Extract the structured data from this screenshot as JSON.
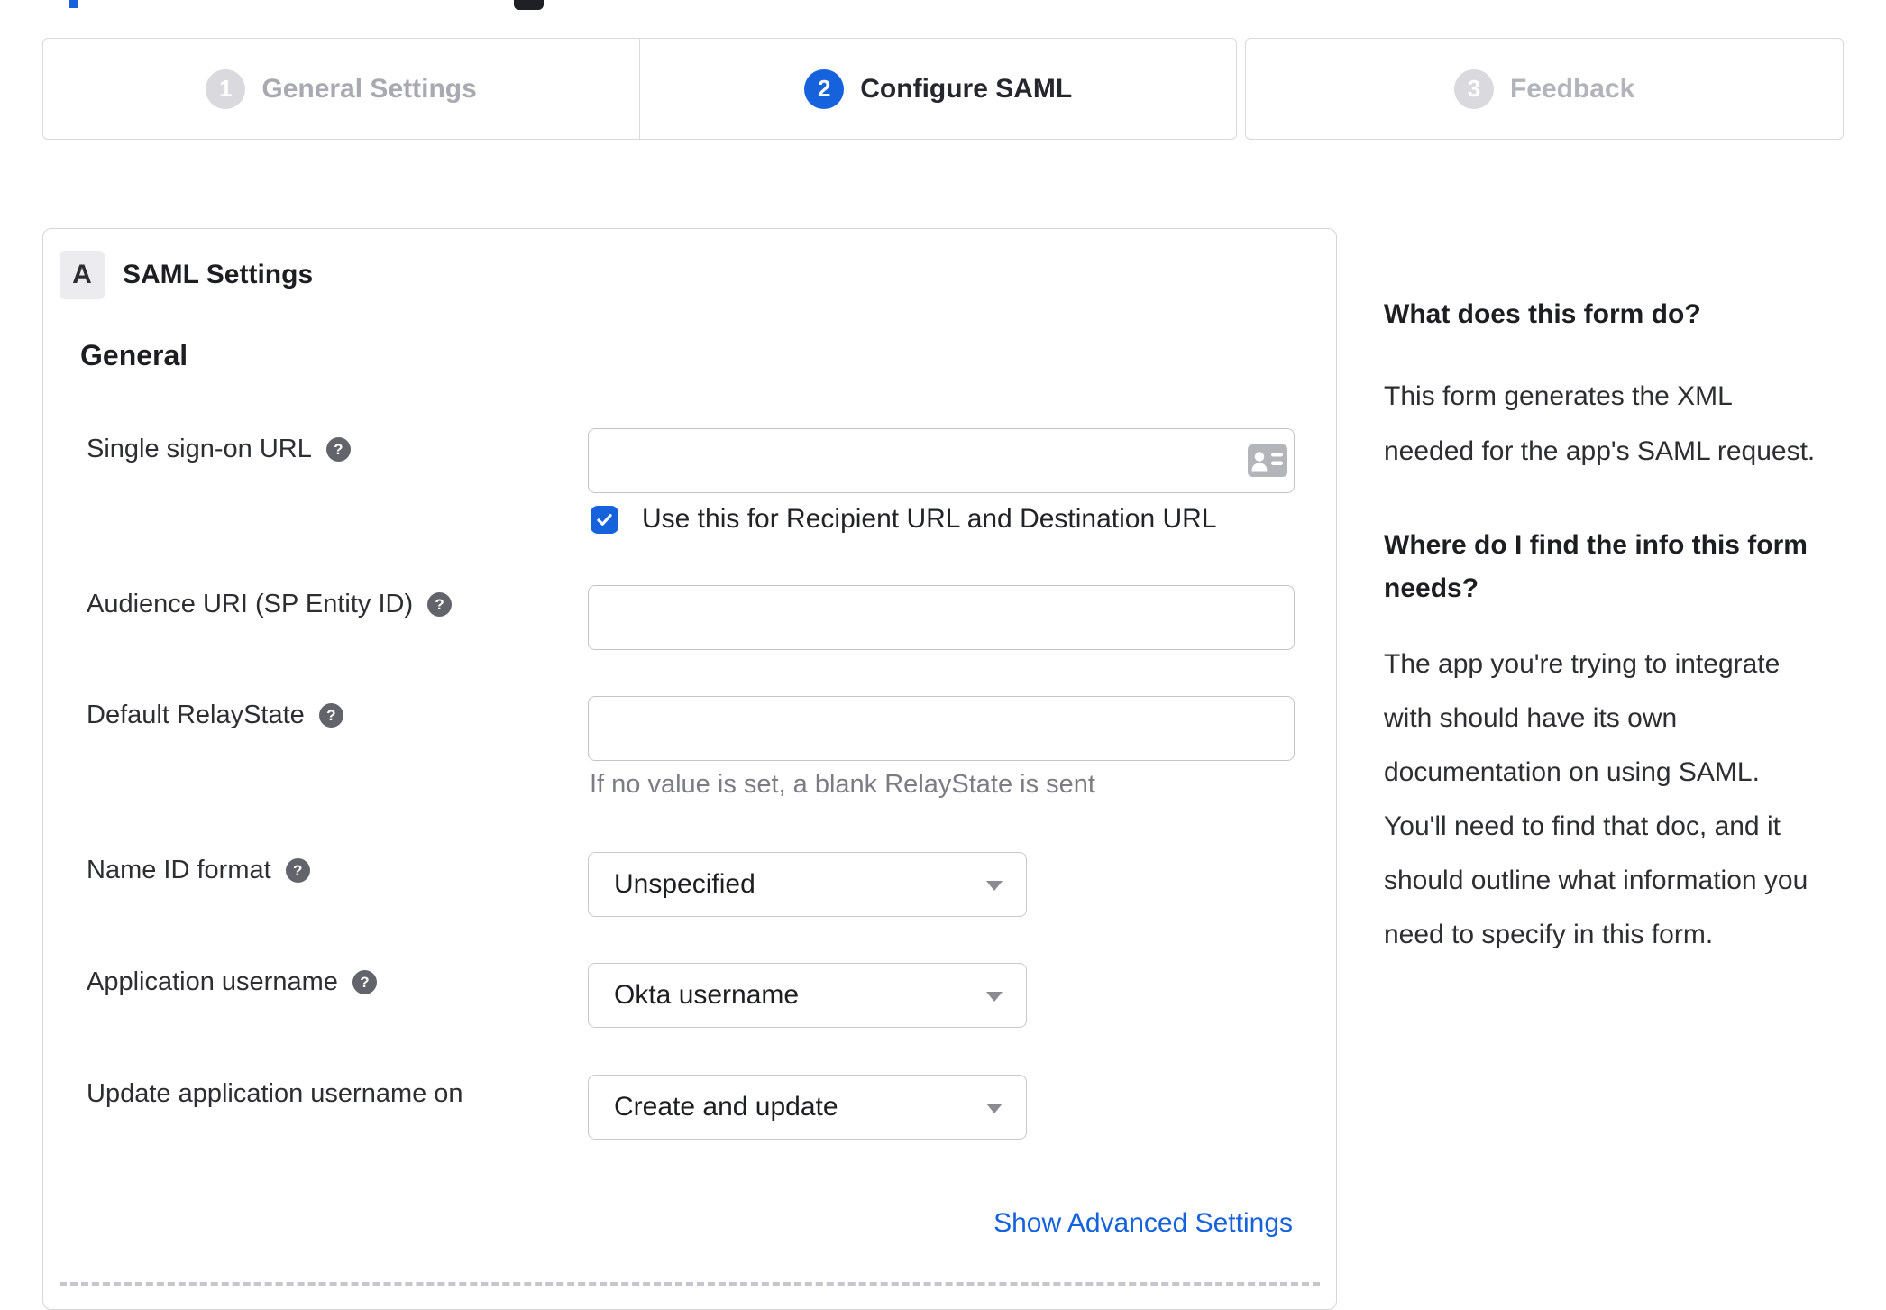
{
  "colors": {
    "accent_blue": "#1662dd",
    "inactive_gray": "#d9d9de",
    "border_gray": "#d5d5da"
  },
  "icons": {
    "help_glyph": "?",
    "check_icon": "checkmark",
    "caret_icon": "dropdown-caret",
    "contact_card_icon": "contact-card"
  },
  "stepper": {
    "steps": [
      {
        "number": "1",
        "label": "General Settings",
        "state": "inactive"
      },
      {
        "number": "2",
        "label": "Configure SAML",
        "state": "active"
      },
      {
        "number": "3",
        "label": "Feedback",
        "state": "upcoming"
      }
    ]
  },
  "panel": {
    "section_badge": "A",
    "section_title": "SAML Settings",
    "group_heading": "General",
    "fields": [
      {
        "label": "Single sign-on URL",
        "type": "text",
        "value": "",
        "has_help": true,
        "trailing_icon": "contact-card-icon",
        "checkbox": {
          "checked": true,
          "label": "Use this for Recipient URL and Destination URL"
        }
      },
      {
        "label": "Audience URI (SP Entity ID)",
        "type": "text",
        "value": "",
        "has_help": true
      },
      {
        "label": "Default RelayState",
        "type": "text",
        "value": "",
        "has_help": true,
        "helper": "If no value is set, a blank RelayState is sent"
      },
      {
        "label": "Name ID format",
        "type": "select",
        "value": "Unspecified",
        "has_help": true
      },
      {
        "label": "Application username",
        "type": "select",
        "value": "Okta username",
        "has_help": true
      },
      {
        "label": "Update application username on",
        "type": "select",
        "value": "Create and update",
        "has_help": false
      }
    ],
    "advanced_link": "Show Advanced Settings"
  },
  "sidebar": {
    "sections": [
      {
        "heading": "What does this form do?",
        "body": "This form generates the XML needed for the app's SAML request."
      },
      {
        "heading": "Where do I find the info this form needs?",
        "body": "The app you're trying to integrate with should have its own documentation on using SAML. You'll need to find that doc, and it should outline what information you need to specify in this form."
      }
    ]
  }
}
